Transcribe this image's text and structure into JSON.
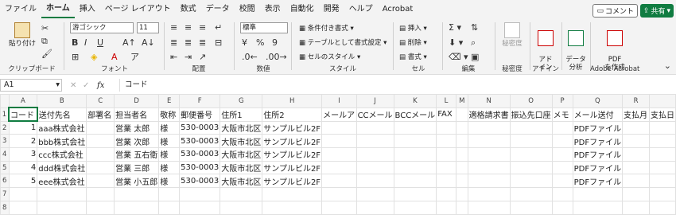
{
  "menu": {
    "tabs": [
      "ファイル",
      "ホーム",
      "挿入",
      "ページ レイアウト",
      "数式",
      "データ",
      "校閲",
      "表示",
      "自動化",
      "開発",
      "ヘルプ",
      "Acrobat"
    ],
    "comment_label": "コメント",
    "share_label": "共有"
  },
  "ribbon": {
    "clipboard": {
      "paste": "貼り付け",
      "label": "クリップボード"
    },
    "font": {
      "name": "游ゴシック",
      "size": "11",
      "label": "フォント"
    },
    "alignment": {
      "label": "配置"
    },
    "number": {
      "format": "標準",
      "label": "数値"
    },
    "styles": {
      "conditional": "条件付き書式",
      "table": "テーブルとして書式設定",
      "cell_styles": "セルのスタイル",
      "label": "スタイル"
    },
    "cells": {
      "insert": "挿入",
      "delete": "削除",
      "format": "書式",
      "label": "セル"
    },
    "editing": {
      "label": "編集"
    },
    "sensitivity": {
      "btn": "秘密度",
      "label": "秘密度"
    },
    "addins": {
      "btn": "アド\nイン",
      "label": "アドイン"
    },
    "analysis": {
      "btn": "データ\n分析",
      "label": ""
    },
    "acrobat": {
      "btn": "PDF\nを作成",
      "label": "Adobe Acrobat"
    }
  },
  "formula_bar": {
    "cell_ref": "A1",
    "fx": "fx",
    "content": "コード"
  },
  "columns": [
    "A",
    "B",
    "C",
    "D",
    "E",
    "F",
    "G",
    "H",
    "I",
    "J",
    "K",
    "L",
    "M",
    "N",
    "O",
    "P",
    "Q",
    "R"
  ],
  "rows": [
    [
      "コード",
      "送付先名",
      "部署名",
      "担当者名",
      "敬称",
      "郵便番号",
      "住所1",
      "住所2",
      "メールア",
      "CCメール",
      "BCCメール",
      "FAX",
      "",
      "適格請求書",
      "振込先口座",
      "メモ",
      "メール送付",
      "支払月",
      "支払日"
    ],
    [
      "1",
      "aaa株式会社",
      "",
      "営業 太郎",
      "様",
      "530-0003",
      "大阪市北区",
      "サンプルビル2F",
      "",
      "",
      "",
      "",
      "",
      "",
      "",
      "",
      "PDFファイル",
      "",
      ""
    ],
    [
      "2",
      "bbb株式会社",
      "",
      "営業 次郎",
      "様",
      "530-0003",
      "大阪市北区",
      "サンプルビル2F",
      "",
      "",
      "",
      "",
      "",
      "",
      "",
      "",
      "PDFファイル",
      "",
      ""
    ],
    [
      "3",
      "ccc株式会社",
      "",
      "営業 五右衛",
      "様",
      "530-0003",
      "大阪市北区",
      "サンプルビル2F",
      "",
      "",
      "",
      "",
      "",
      "",
      "",
      "",
      "PDFファイル",
      "",
      ""
    ],
    [
      "4",
      "ddd株式会社",
      "",
      "営業 三郎",
      "様",
      "530-0003",
      "大阪市北区",
      "サンプルビル2F",
      "",
      "",
      "",
      "",
      "",
      "",
      "",
      "",
      "PDFファイル",
      "",
      ""
    ],
    [
      "5",
      "eee株式会社",
      "",
      "営業 小五郎",
      "様",
      "530-0003",
      "大阪市北区",
      "サンプルビル2F",
      "",
      "",
      "",
      "",
      "",
      "",
      "",
      "",
      "PDFファイル",
      "",
      ""
    ],
    [
      "",
      "",
      "",
      "",
      "",
      "",
      "",
      "",
      "",
      "",
      "",
      "",
      "",
      "",
      "",
      "",
      "",
      "",
      ""
    ],
    [
      "",
      "",
      "",
      "",
      "",
      "",
      "",
      "",
      "",
      "",
      "",
      "",
      "",
      "",
      "",
      "",
      "",
      "",
      ""
    ]
  ]
}
